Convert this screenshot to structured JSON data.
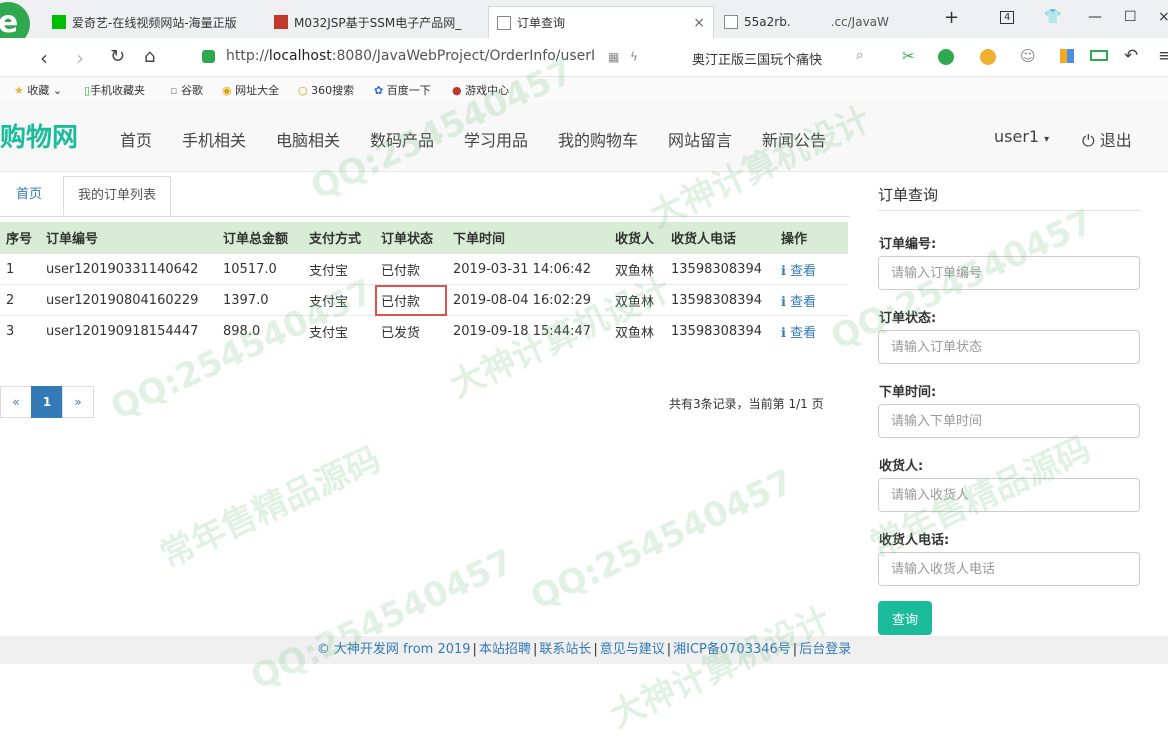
{
  "browser": {
    "tabs": [
      {
        "label": "爱奇艺-在线视频网站-海量正版",
        "icon_color": "#00be06"
      },
      {
        "label": "M032JSP基于SSM电子产品网_",
        "icon_color": "#c0392b"
      },
      {
        "label": "订单查询"
      },
      {
        "label": "55a2rb.",
        "extra": ".cc/JavaW"
      }
    ],
    "tab_close": "×",
    "new_tab": "+",
    "tab_count": "4",
    "url_host": "localhost",
    "url_prefix": "http://",
    "url_rest": ":8080/JavaWebProject/OrderInfo/userI",
    "search_hint": "奥汀正版三国玩个痛快",
    "bookmarks": [
      "收藏",
      "手机收藏夹",
      "谷歌",
      "网址大全",
      "360搜索",
      "百度一下",
      "游戏中心"
    ]
  },
  "navbar": {
    "brand": "购物网",
    "links": [
      "首页",
      "手机相关",
      "电脑相关",
      "数码产品",
      "学习用品",
      "我的购物车",
      "网站留言",
      "新闻公告"
    ],
    "user": "user1",
    "logout": "退出"
  },
  "breadcrumb": {
    "home": "首页",
    "current": "我的订单列表"
  },
  "orders": {
    "headers": [
      "序号",
      "订单编号",
      "订单总金额",
      "支付方式",
      "订单状态",
      "下单时间",
      "收货人",
      "收货人电话",
      "操作"
    ],
    "rows": [
      [
        "1",
        "user120190331140642",
        "10517.0",
        "支付宝",
        "已付款",
        "2019-03-31 14:06:42",
        "双鱼林",
        "13598308394",
        "查看"
      ],
      [
        "2",
        "user120190804160229",
        "1397.0",
        "支付宝",
        "已付款",
        "2019-08-04 16:02:29",
        "双鱼林",
        "13598308394",
        "查看"
      ],
      [
        "3",
        "user120190918154447",
        "898.0",
        "支付宝",
        "已发货",
        "2019-09-18 15:44:47",
        "双鱼林",
        "13598308394",
        "查看"
      ]
    ],
    "highlighted_status_row": 2
  },
  "pager": {
    "prev": "«",
    "current": "1",
    "next": "»",
    "summary": "共有3条记录，当前第 1/1 页"
  },
  "query": {
    "title": "订单查询",
    "fields": [
      {
        "label": "订单编号:",
        "placeholder": "请输入订单编号"
      },
      {
        "label": "订单状态:",
        "placeholder": "请输入订单状态"
      },
      {
        "label": "下单时间:",
        "placeholder": "请输入下单时间"
      },
      {
        "label": "收货人:",
        "placeholder": "请输入收货人"
      },
      {
        "label": "收货人电话:",
        "placeholder": "请输入收货人电话"
      }
    ],
    "button": "查询"
  },
  "footer": {
    "items": [
      "© 大神开发网 from 2019",
      "本站招聘",
      "联系站长",
      "意见与建议",
      "湘ICP备0703346号",
      "后台登录"
    ]
  },
  "watermarks": [
    "QQ:254540457",
    "大神计算机设计",
    "常年售精品源码"
  ],
  "colors": {
    "brand": "#1abc9c",
    "link": "#337ab7",
    "table_header": "#d9edd6",
    "highlight": "#d9534f"
  }
}
